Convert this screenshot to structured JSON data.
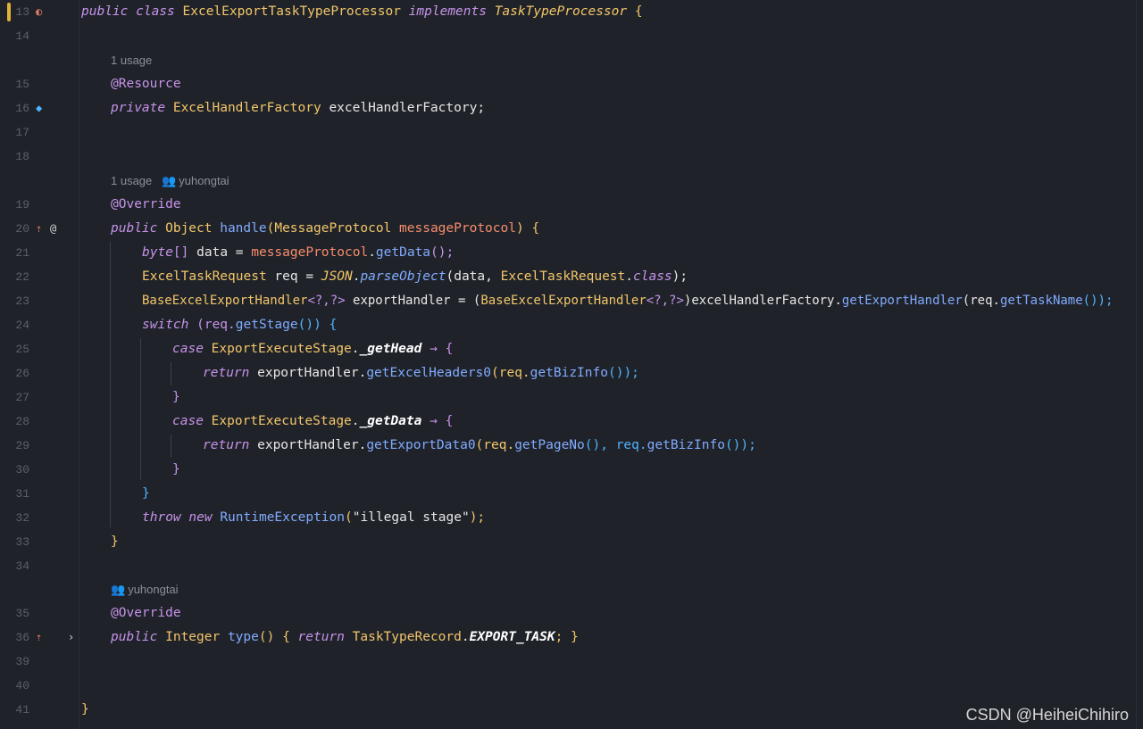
{
  "editor": {
    "lines": [
      {
        "n": "13"
      },
      {
        "n": "14"
      },
      {
        "n": "15"
      },
      {
        "n": "16"
      },
      {
        "n": "17"
      },
      {
        "n": "18"
      },
      {
        "n": "19"
      },
      {
        "n": "20"
      },
      {
        "n": "21"
      },
      {
        "n": "22"
      },
      {
        "n": "23"
      },
      {
        "n": "24"
      },
      {
        "n": "25"
      },
      {
        "n": "26"
      },
      {
        "n": "27"
      },
      {
        "n": "28"
      },
      {
        "n": "29"
      },
      {
        "n": "30"
      },
      {
        "n": "31"
      },
      {
        "n": "32"
      },
      {
        "n": "33"
      },
      {
        "n": "34"
      },
      {
        "n": "35"
      },
      {
        "n": "36"
      },
      {
        "n": "39"
      },
      {
        "n": "40"
      },
      {
        "n": "41"
      }
    ],
    "hints": {
      "usage1": "1 usage",
      "usage2": "1 usage",
      "author1": "yuhongtai",
      "author2": "yuhongtai"
    },
    "code": {
      "l13": {
        "kw1": "public class ",
        "cls": "ExcelExportTaskTypeProcessor",
        "kw2": " implements ",
        "iface": "TaskTypeProcessor",
        "brace": " {"
      },
      "l15": "@Resource",
      "l16": {
        "kw": "private ",
        "type": "ExcelHandlerFactory",
        "rest": " excelHandlerFactory;"
      },
      "l19": "@Override",
      "l20": {
        "kw": "public ",
        "type": "Object ",
        "fn": "handle",
        "p1": "(",
        "ptype": "MessageProtocol ",
        "pname": "messageProtocol",
        "p2": ") {"
      },
      "l21": {
        "kw": "byte",
        "b": "[] ",
        "rest1": "data = ",
        "var": "messageProtocol",
        "dot": ".",
        "fn": "getData",
        "end": "();"
      },
      "l22": {
        "type": "ExcelTaskRequest",
        "rest1": " req = ",
        "json": "JSON",
        "dot": ".",
        "fn": "parseObject",
        "rest2": "(data, ",
        "type2": "ExcelTaskRequest",
        "dot2": ".",
        "kw": "class",
        "end": ");"
      },
      "l23": {
        "type": "BaseExcelExportHandler",
        "gen": "<?,?>",
        "rest1": " exportHandler = (",
        "type2": "BaseExcelExportHandler",
        "gen2": "<?,?>",
        "rest2": ")excelHandlerFactory.",
        "fn": "getExportHandler",
        "p": "(req.",
        "fn2": "getTaskName",
        "end": "());"
      },
      "l24": {
        "kw": "switch ",
        "rest": "(req.",
        "fn": "getStage",
        "end": "()) {"
      },
      "l25": {
        "kw": "case ",
        "type": "ExportExecuteStage",
        "dot": ".",
        "enum": "_getHead",
        "arrow": " → {"
      },
      "l26": {
        "kw": "return ",
        "rest": "exportHandler.",
        "fn": "getExcelHeaders0",
        "p": "(req.",
        "fn2": "getBizInfo",
        "end": "());"
      },
      "l27": "}",
      "l28": {
        "kw": "case ",
        "type": "ExportExecuteStage",
        "dot": ".",
        "enum": "_getData",
        "arrow": " → {"
      },
      "l29": {
        "kw": "return ",
        "rest": "exportHandler.",
        "fn": "getExportData0",
        "p": "(req.",
        "fn2": "getPageNo",
        "mid": "(), req.",
        "fn3": "getBizInfo",
        "end": "());"
      },
      "l30": "}",
      "l31": "}",
      "l32": {
        "kw": "throw new ",
        "fn": "RuntimeException",
        "p": "(",
        "str": "\"illegal stage\"",
        "end": ");"
      },
      "l33": "}",
      "l35": "@Override",
      "l36": {
        "kw": "public ",
        "type": "Integer ",
        "fn": "type",
        "p": "() { ",
        "kw2": "return ",
        "type2": "TaskTypeRecord",
        "dot": ".",
        "cst": "EXPORT_TASK",
        "end": "; }"
      },
      "l41": "}"
    }
  },
  "watermark": "CSDN @HeiheiChihiro",
  "colors": {
    "background": "#1f2329",
    "keyword": "#c792ea",
    "type": "#f3c56a",
    "function": "#82aaff",
    "parameter": "#f78c6c",
    "line_number": "#5b6068"
  }
}
